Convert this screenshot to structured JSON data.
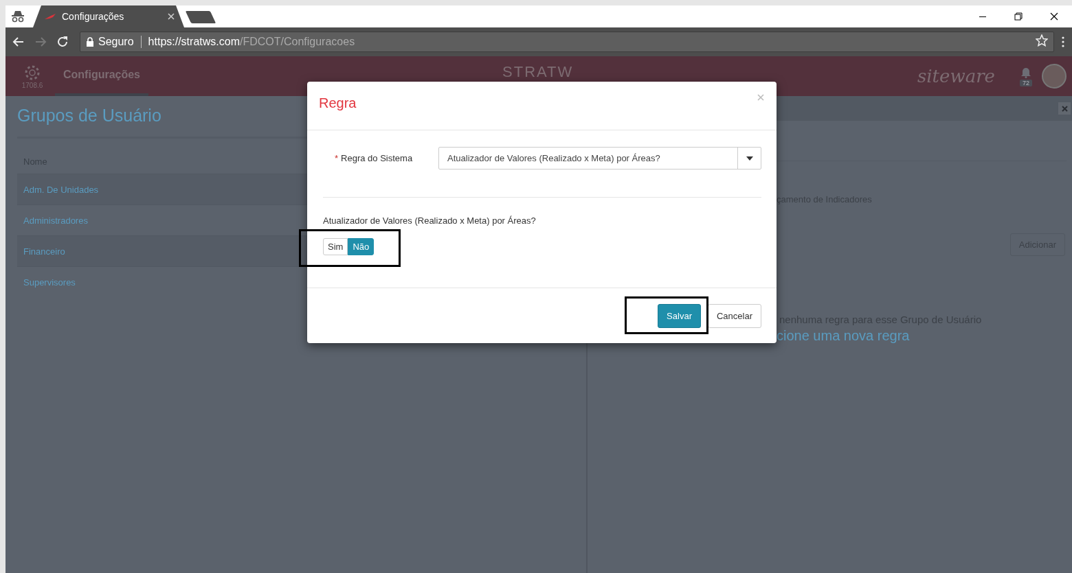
{
  "browser": {
    "tab_title": "Configurações",
    "security": "Seguro",
    "url_host": "https://stratws.com",
    "url_path": "/FDCOT/Configuracoes",
    "forward_disabled": true
  },
  "app_header": {
    "version": "1708.6",
    "nav": [
      {
        "label": "Configurações",
        "selected": true
      }
    ],
    "logo": "STRATW",
    "brand": "siteware",
    "notifications": "72"
  },
  "left_panel": {
    "title": "Grupos de Usuário",
    "column": "Nome",
    "rows": [
      {
        "name": "Adm. De Unidades"
      },
      {
        "name": "Administradores"
      },
      {
        "name": "Financeiro"
      },
      {
        "name": "Supervisores"
      }
    ]
  },
  "right_panel": {
    "text_fragment": "çamento de Indicadores",
    "add_button": "Adicionar",
    "empty_line": "nenhuma regra para esse Grupo de Usuário",
    "empty_cta": "cione uma nova regra"
  },
  "modal": {
    "title": "Regra",
    "field_label": "Regra do Sistema",
    "required_mark": "*",
    "field_value": "Atualizador de Valores (Realizado x Meta) por Áreas?",
    "question": "Atualizador de Valores (Realizado x Meta) por Áreas?",
    "options": [
      {
        "label": "Sim",
        "selected": false
      },
      {
        "label": "Não",
        "selected": true
      }
    ],
    "buttons": [
      {
        "label": "Salvar",
        "kind": "primary"
      },
      {
        "label": "Cancelar",
        "kind": "default"
      }
    ]
  }
}
